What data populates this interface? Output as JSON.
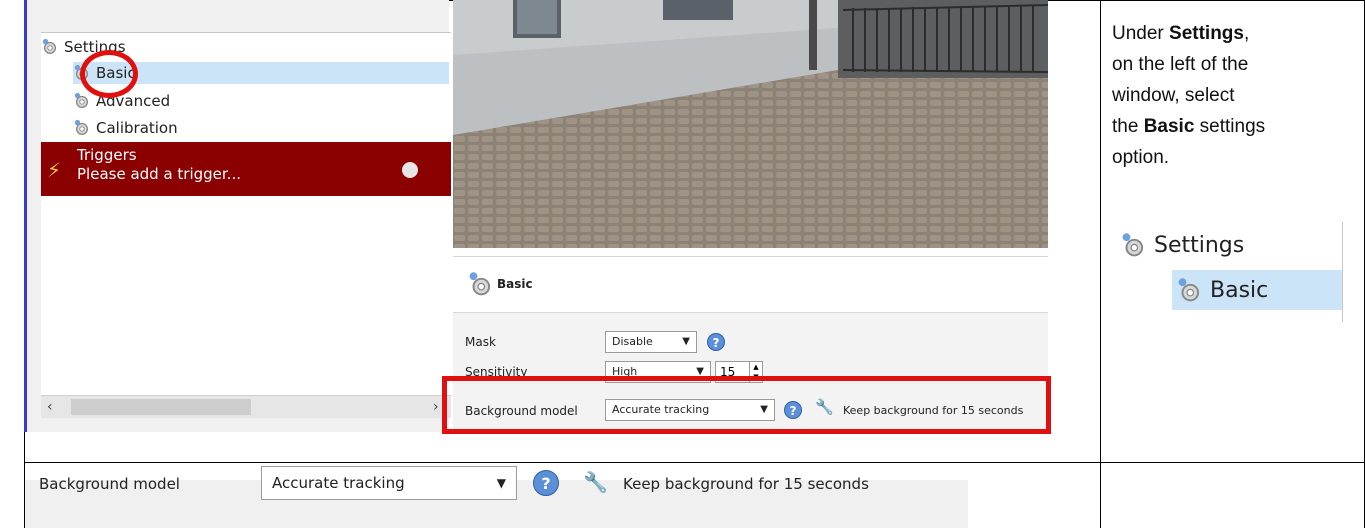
{
  "tree": {
    "settings_label": "Settings",
    "basic_label": "Basic",
    "advanced_label": "Advanced",
    "calibration_label": "Calibration",
    "triggers_label": "Triggers",
    "triggers_hint": "Please add a trigger..."
  },
  "settings_panel": {
    "title": "Basic",
    "mask_label": "Mask",
    "mask_value": "Disable",
    "sensitivity_label": "Sensitivity",
    "sensitivity_value": "High",
    "sensitivity_number": "15",
    "bg_model_label": "Background model",
    "bg_model_value": "Accurate tracking",
    "bg_keep_text": "Keep background for 15 seconds"
  },
  "instructions": {
    "line1_pre": "Under ",
    "line1_bold": "Settings",
    "line1_post": ",",
    "line2": "on the left of the",
    "line3": "window, select",
    "line4_pre": "the ",
    "line4_bold": "Basic",
    "line4_post": " settings",
    "line5": "option."
  },
  "inset": {
    "settings_label": "Settings",
    "basic_label": "Basic"
  },
  "zoom_strip": {
    "bg_model_label": "Background model",
    "bg_model_value": "Accurate tracking",
    "bg_keep_text": "Keep background for 15 seconds"
  },
  "icons": {
    "gear": "gear-icon",
    "help": "help-icon",
    "wrench": "wrench-icon",
    "bolt": "lightning-icon",
    "add": "add-icon"
  },
  "colors": {
    "triggers_bg": "#8b0000",
    "selection_bg": "#cce4f7",
    "highlight": "#e01010"
  }
}
